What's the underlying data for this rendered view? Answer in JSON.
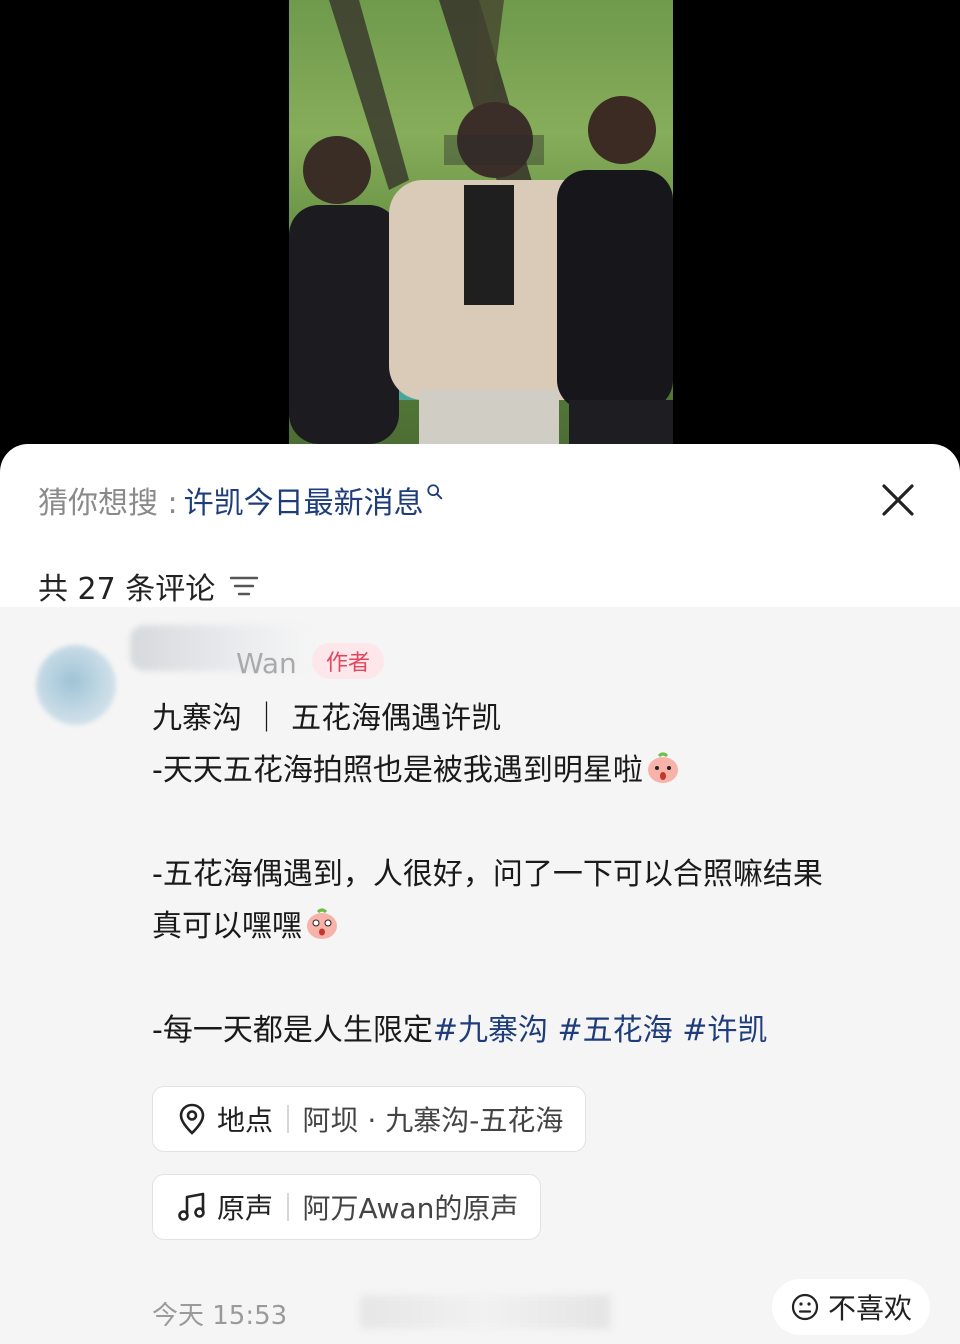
{
  "suggest": {
    "label": "猜你想搜 : ",
    "query": "许凯今日最新消息"
  },
  "comments_header": {
    "count_text": "共 27 条评论"
  },
  "comment": {
    "username": "Wan",
    "badge": "作者",
    "lines": [
      "九寨沟 ｜ 五花海偶遇许凯",
      "-天天五花海拍照也是被我遇到明星啦",
      "-五花海偶遇到，人很好，问了一下可以合照嘛结果",
      "真可以嘿嘿",
      "-每一天都是人生限定"
    ],
    "hashtags": [
      "#九寨沟",
      "#五花海",
      "#许凯"
    ],
    "location": {
      "label": "地点",
      "value": "阿坝 · 九寨沟-五花海"
    },
    "sound": {
      "label": "原声",
      "value": "阿万Awan的原声"
    },
    "time": "今天 15:53",
    "dislike_label": "不喜欢"
  },
  "colors": {
    "link": "#1f3d7a",
    "badge_bg": "#fde7ea",
    "badge_text": "#e0485f",
    "card_bg": "#f5f5f5"
  }
}
